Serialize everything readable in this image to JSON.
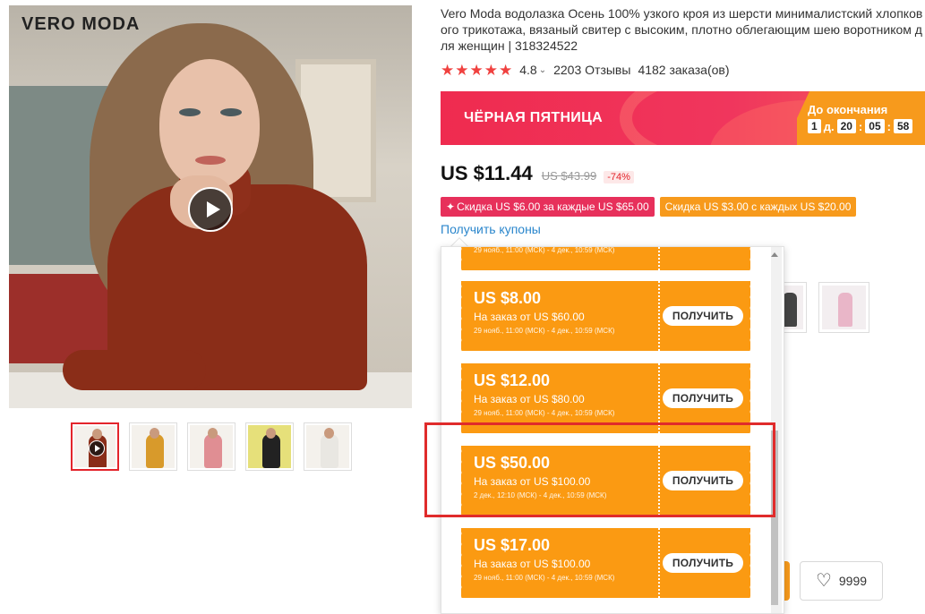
{
  "brand": {
    "logo_text": "VERO MODA"
  },
  "gallery": {
    "main_has_video": true,
    "thumbnails": [
      {
        "name": "rust-turtleneck-video",
        "active": true,
        "video": true,
        "color": "#8a2d18"
      },
      {
        "name": "mustard-turtleneck",
        "active": false,
        "video": false,
        "color": "#d89a2b"
      },
      {
        "name": "pink-turtleneck",
        "active": false,
        "video": false,
        "color": "#e08e93"
      },
      {
        "name": "black-turtleneck",
        "active": false,
        "video": false,
        "color": "#222222"
      },
      {
        "name": "white-turtleneck",
        "active": false,
        "video": false,
        "color": "#e9e7e2"
      }
    ]
  },
  "product": {
    "title": "Vero Moda водолазка Осень 100% узкого кроя из шерсти минималистский хлопкового трикотажа, вязаный свитер с высоким, плотно облегающим шею воротником для женщин | 318324522",
    "rating": "4.8",
    "rating_stars": 5,
    "reviews": "2203 Отзывы",
    "orders": "4182 заказа(ов)"
  },
  "banner": {
    "title": "ЧЁРНАЯ ПЯТНИЦА",
    "timer_label": "До окончания",
    "days": "1",
    "days_unit": "д.",
    "hours": "20",
    "minutes": "05",
    "seconds": "58"
  },
  "price": {
    "current": "US $11.44",
    "old": "US $43.99",
    "discount": "-74%"
  },
  "promos": {
    "store_discount": "Скидка US $6.00 за каждые US $65.00",
    "extra_discount": "Скидка US $3.00 с каждых US $20.00",
    "get_coupons": "Получить купоны"
  },
  "coupon_popup": {
    "coupons": [
      {
        "amount": "",
        "min_order": "",
        "dates": "29 нояб., 11:00 (МСК) - 4 дек., 10:59 (МСК)",
        "button": ""
      },
      {
        "amount": "US $8.00",
        "min_order": "На заказ от US $60.00",
        "dates": "29 нояб., 11:00 (МСК) - 4 дек., 10:59 (МСК)",
        "button": "ПОЛУЧИТЬ"
      },
      {
        "amount": "US $12.00",
        "min_order": "На заказ от US $80.00",
        "dates": "29 нояб., 11:00 (МСК) - 4 дек., 10:59 (МСК)",
        "button": "ПОЛУЧИТЬ"
      },
      {
        "amount": "US $50.00",
        "min_order": "На заказ от US $100.00",
        "dates": "2 дек., 12:10 (МСК) - 4 дек., 10:59 (МСК)",
        "button": "ПОЛУЧИТЬ",
        "highlighted": true
      },
      {
        "amount": "US $17.00",
        "min_order": "На заказ от US $100.00",
        "dates": "29 нояб., 11:00 (МСК) - 4 дек., 10:59 (МСК)",
        "button": "ПОЛУЧИТЬ"
      }
    ]
  },
  "actions": {
    "wishlist_count": "9999"
  },
  "colors": {
    "accent_red": "#e3242b",
    "coupon_orange": "#fb9a12",
    "banner_pink": "#ef2b4f",
    "link_blue": "#2a86cc"
  }
}
